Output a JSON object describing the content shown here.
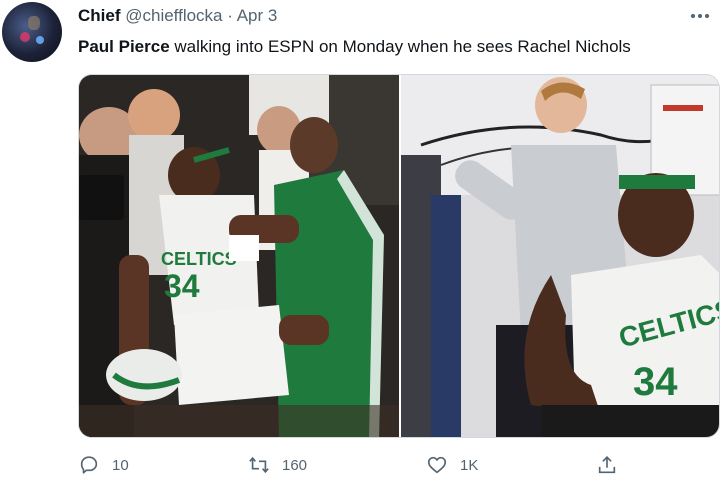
{
  "tweet": {
    "display_name": "Chief",
    "handle": "@chiefflocka",
    "separator": "·",
    "date": "Apr 3",
    "text_bold": "Paul Pierce",
    "text_rest": " walking into ESPN on Monday when he sees Rachel Nichols"
  },
  "media": {
    "left_jersey_text": "CELTICS",
    "left_jersey_number": "34",
    "right_jersey_text": "CELTICS",
    "right_jersey_number": "34"
  },
  "actions": {
    "reply_count": "10",
    "retweet_count": "160",
    "like_count": "1K"
  },
  "icons": {
    "more": "more-icon",
    "reply": "reply-icon",
    "retweet": "retweet-icon",
    "like": "like-icon",
    "share": "share-icon"
  },
  "colors": {
    "text_primary": "#0f1419",
    "text_secondary": "#536471",
    "celtics_green": "#1f7a3e"
  }
}
